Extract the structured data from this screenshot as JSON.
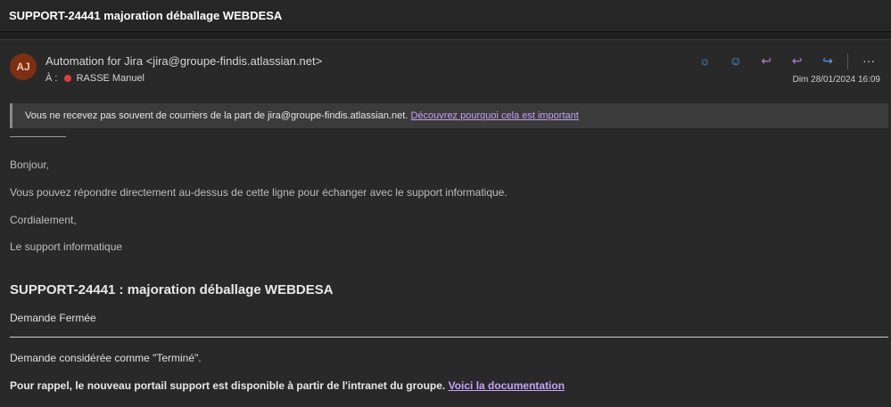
{
  "window": {
    "subject": "SUPPORT-24441 majoration déballage WEBDESA"
  },
  "header": {
    "avatar_initials": "AJ",
    "from": "Automation for Jira <jira@groupe-findis.atlassian.net>",
    "to_label": "À :",
    "to_name": "RASSE Manuel",
    "date": "Dim 28/01/2024 16:09",
    "actions": [
      {
        "name": "brightness-icon",
        "glyph": "☼",
        "color": "#4ea0f5"
      },
      {
        "name": "emoji-icon",
        "glyph": "☺",
        "color": "#4ea0f5"
      },
      {
        "name": "reply-icon",
        "glyph": "↩",
        "color": "#b07ad8"
      },
      {
        "name": "reply-all-icon",
        "glyph": "↩",
        "color": "#b07ad8"
      },
      {
        "name": "forward-icon",
        "glyph": "↪",
        "color": "#4ea0f5"
      },
      {
        "name": "more-icon",
        "glyph": "···",
        "color": "#cfcfcf"
      }
    ]
  },
  "notice": {
    "text": "Vous ne recevez pas souvent de courriers de la part de jira@groupe-findis.atlassian.net.",
    "link": "Découvrez pourquoi cela est important"
  },
  "body": {
    "greeting": "Bonjour,",
    "line1": "Vous pouvez répondre directement au-dessus de cette ligne pour échanger avec le support informatique.",
    "closing": "Cordialement,",
    "signature": "Le support informatique",
    "heading": "SUPPORT-24441 : majoration déballage WEBDESA",
    "status": "Demande Fermée",
    "considered": "Demande considérée comme \"Terminé\".",
    "reminder": "Pour rappel, le nouveau portail support est disponible à partir de l'intranet du groupe.",
    "reminder_link": "Voici la documentation"
  },
  "colors": {
    "background": "#1f1f1f",
    "panel": "#292929",
    "link": "#c5a3f2",
    "avatar": "#7e2f12",
    "presence_dot": "#e03c3c"
  }
}
